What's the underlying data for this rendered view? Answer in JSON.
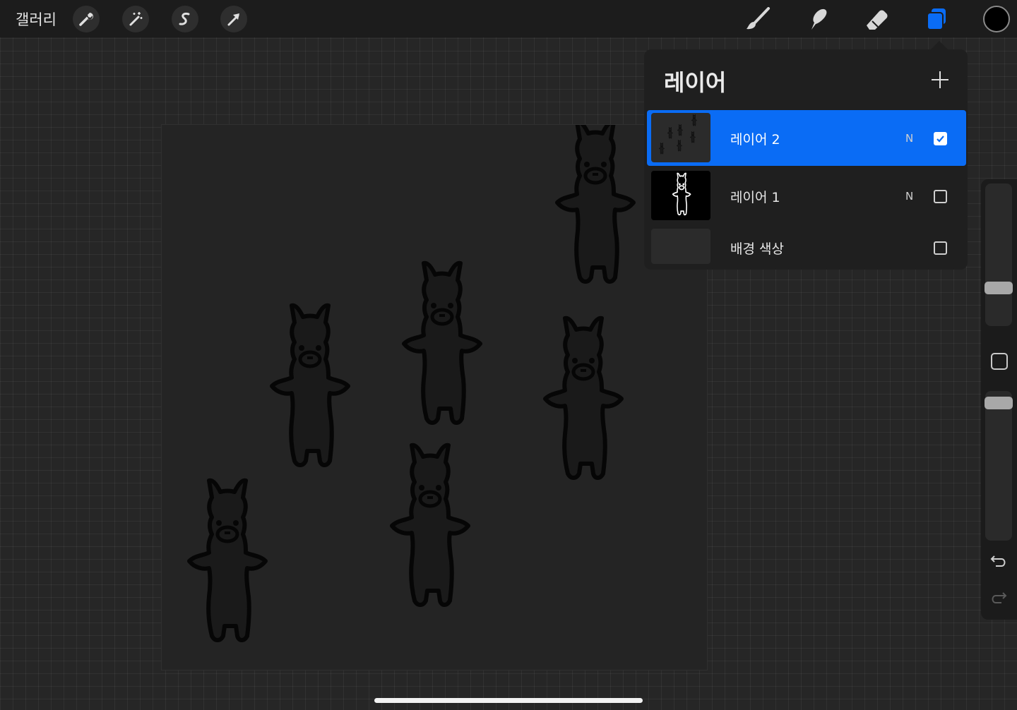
{
  "topbar": {
    "gallery_label": "갤러리",
    "left_tools": [
      "wrench-icon",
      "magic-wand-icon",
      "selection-s-icon",
      "transform-arrow-icon"
    ],
    "right_tools": [
      "brush-icon",
      "smudge-icon",
      "eraser-icon",
      "layers-icon"
    ],
    "active_tool": "layers-icon",
    "accent_color": "#0a6cf5",
    "current_color": "#000000"
  },
  "layers_panel": {
    "title": "레이어",
    "add_icon": "plus-icon",
    "layers": [
      {
        "name": "레이어 2",
        "blend": "N",
        "visible": true,
        "selected": true
      },
      {
        "name": "레이어 1",
        "blend": "N",
        "visible": false,
        "selected": false
      },
      {
        "name": "배경 색상",
        "blend": "",
        "visible": false,
        "selected": false
      }
    ]
  },
  "sidebar": {
    "brush_size_level": 0.35,
    "opacity_level": 0.85,
    "undo_icon": "undo-icon",
    "redo_icon": "redo-icon"
  }
}
